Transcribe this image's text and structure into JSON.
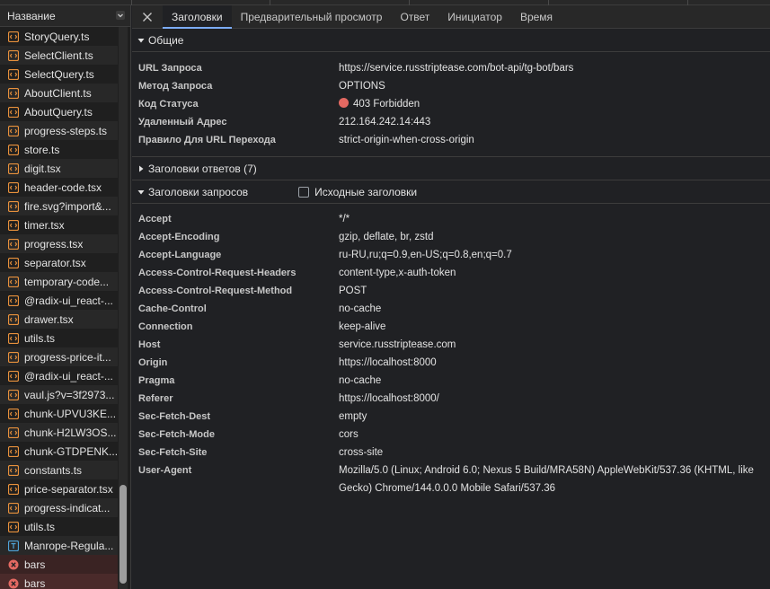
{
  "left_panel": {
    "header": "Название",
    "files": [
      {
        "name": "StoryQuery.ts",
        "icon": "script-file-icon",
        "status": "ok"
      },
      {
        "name": "SelectClient.ts",
        "icon": "script-file-icon",
        "status": "ok"
      },
      {
        "name": "SelectQuery.ts",
        "icon": "script-file-icon",
        "status": "ok"
      },
      {
        "name": "AboutClient.ts",
        "icon": "script-file-icon",
        "status": "ok"
      },
      {
        "name": "AboutQuery.ts",
        "icon": "script-file-icon",
        "status": "ok"
      },
      {
        "name": "progress-steps.ts",
        "icon": "script-file-icon",
        "status": "ok"
      },
      {
        "name": "store.ts",
        "icon": "script-file-icon",
        "status": "ok"
      },
      {
        "name": "digit.tsx",
        "icon": "script-file-icon",
        "status": "ok"
      },
      {
        "name": "header-code.tsx",
        "icon": "script-file-icon",
        "status": "ok"
      },
      {
        "name": "fire.svg?import&...",
        "icon": "script-file-icon",
        "status": "ok"
      },
      {
        "name": "timer.tsx",
        "icon": "script-file-icon",
        "status": "ok"
      },
      {
        "name": "progress.tsx",
        "icon": "script-file-icon",
        "status": "ok"
      },
      {
        "name": "separator.tsx",
        "icon": "script-file-icon",
        "status": "ok"
      },
      {
        "name": "temporary-code...",
        "icon": "script-file-icon",
        "status": "ok"
      },
      {
        "name": "@radix-ui_react-...",
        "icon": "script-file-icon",
        "status": "ok"
      },
      {
        "name": "drawer.tsx",
        "icon": "script-file-icon",
        "status": "ok"
      },
      {
        "name": "utils.ts",
        "icon": "script-file-icon",
        "status": "ok"
      },
      {
        "name": "progress-price-it...",
        "icon": "script-file-icon",
        "status": "ok"
      },
      {
        "name": "@radix-ui_react-...",
        "icon": "script-file-icon",
        "status": "ok"
      },
      {
        "name": "vaul.js?v=3f2973...",
        "icon": "script-file-icon",
        "status": "ok"
      },
      {
        "name": "chunk-UPVU3KE...",
        "icon": "script-file-icon",
        "status": "ok"
      },
      {
        "name": "chunk-H2LW3OS...",
        "icon": "script-file-icon",
        "status": "ok"
      },
      {
        "name": "chunk-GTDPENK...",
        "icon": "script-file-icon",
        "status": "ok"
      },
      {
        "name": "constants.ts",
        "icon": "script-file-icon",
        "status": "ok"
      },
      {
        "name": "price-separator.tsx",
        "icon": "script-file-icon",
        "status": "ok"
      },
      {
        "name": "progress-indicat...",
        "icon": "script-file-icon",
        "status": "ok"
      },
      {
        "name": "utils.ts",
        "icon": "script-file-icon",
        "status": "ok"
      },
      {
        "name": "Manrope-Regula...",
        "icon": "font-file-icon",
        "status": "ok"
      },
      {
        "name": "bars",
        "icon": "error-icon",
        "status": "error"
      },
      {
        "name": "bars",
        "icon": "error-icon",
        "status": "error-selected"
      }
    ]
  },
  "tabs": {
    "close_icon": "close-icon",
    "items": [
      "Заголовки",
      "Предварительный просмотр",
      "Ответ",
      "Инициатор",
      "Время"
    ],
    "active": "Заголовки"
  },
  "general": {
    "title": "Общие",
    "rows": [
      {
        "key": "URL Запроса",
        "value": "https://service.russtriptease.com/bot-api/tg-bot/bars"
      },
      {
        "key": "Метод Запроса",
        "value": "OPTIONS"
      },
      {
        "key": "Код Статуса",
        "value": "403 Forbidden"
      },
      {
        "key": "Удаленный Адрес",
        "value": "212.164.242.14:443"
      },
      {
        "key": "Правило Для URL Перехода",
        "value": "strict-origin-when-cross-origin"
      }
    ]
  },
  "response_headers": {
    "title": "Заголовки ответов (7)"
  },
  "request_headers": {
    "title": "Заголовки запросов",
    "raw_checkbox_label": "Исходные заголовки",
    "rows": [
      {
        "key": "Accept",
        "value": "*/*"
      },
      {
        "key": "Accept-Encoding",
        "value": "gzip, deflate, br, zstd"
      },
      {
        "key": "Accept-Language",
        "value": "ru-RU,ru;q=0.9,en-US;q=0.8,en;q=0.7"
      },
      {
        "key": "Access-Control-Request-Headers",
        "value": "content-type,x-auth-token"
      },
      {
        "key": "Access-Control-Request-Method",
        "value": "POST"
      },
      {
        "key": "Cache-Control",
        "value": "no-cache"
      },
      {
        "key": "Connection",
        "value": "keep-alive"
      },
      {
        "key": "Host",
        "value": "service.russtriptease.com"
      },
      {
        "key": "Origin",
        "value": "https://localhost:8000"
      },
      {
        "key": "Pragma",
        "value": "no-cache"
      },
      {
        "key": "Referer",
        "value": "https://localhost:8000/"
      },
      {
        "key": "Sec-Fetch-Dest",
        "value": "empty"
      },
      {
        "key": "Sec-Fetch-Mode",
        "value": "cors"
      },
      {
        "key": "Sec-Fetch-Site",
        "value": "cross-site"
      },
      {
        "key": "User-Agent",
        "value": "Mozilla/5.0 (Linux; Android 6.0; Nexus 5 Build/MRA58N) AppleWebKit/537.36 (KHTML, like Gecko) Chrome/144.0.0.0 Mobile Safari/537.36"
      }
    ]
  },
  "colors": {
    "status_error": "#e46962",
    "accent": "#7cacf8",
    "script_icon": "#e8913c",
    "font_icon": "#4fa3d8",
    "error_icon": "#e46962"
  }
}
